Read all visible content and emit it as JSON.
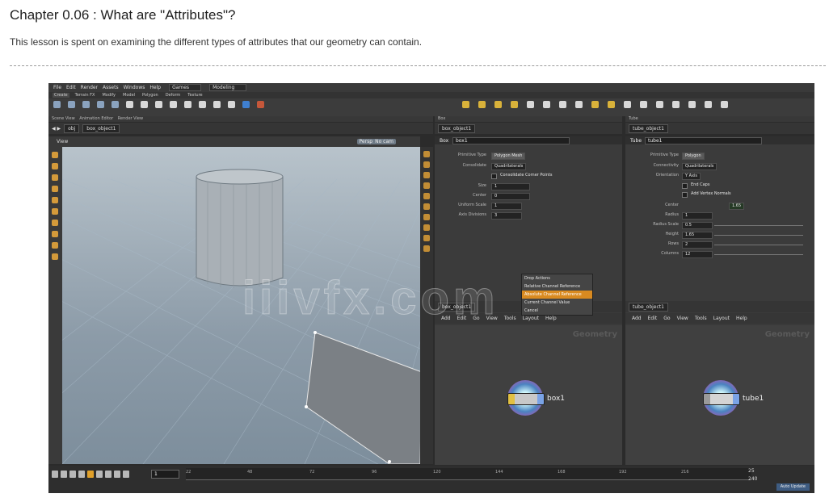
{
  "page": {
    "title": "Chapter 0.06 : What are \"Attributes\"?",
    "description": "This lesson is spent on examining the different types of attributes that our geometry can contain."
  },
  "houdini": {
    "menu": [
      "File",
      "Edit",
      "Render",
      "Assets",
      "Windows",
      "Help"
    ],
    "desktop": "Games",
    "desktop2": "Modeling",
    "viewport": {
      "label": "View",
      "persp": "Persp",
      "camera": "No cam"
    },
    "path_left": "obj",
    "path_left_node": "box_object1",
    "params_box": {
      "node_type": "Box",
      "node_name": "box1",
      "rows": [
        {
          "label": "Primitive Type",
          "value": "Polygon Mesh"
        },
        {
          "label": "Consolidate",
          "value": "Quadrilaterals"
        },
        {
          "label": "",
          "value": "Consolidate Corner Points"
        },
        {
          "label": "Size",
          "value": "1"
        },
        {
          "label": "Center",
          "value": "0"
        },
        {
          "label": "Uniform Scale",
          "value": "1"
        },
        {
          "label": "Axis Divisions",
          "value": "3"
        }
      ]
    },
    "context_menu": [
      "Drop Actions",
      "Relative Channel Reference",
      "Absolute Channel Reference",
      "Current Channel Value",
      "Cancel"
    ],
    "params_tube": {
      "node_type": "Tube",
      "node_name": "tube1",
      "rows": [
        {
          "label": "Primitive Type",
          "value": "Polygon"
        },
        {
          "label": "Connectivity",
          "value": "Quadrilaterals"
        },
        {
          "label": "Orientation",
          "value": "Y Axis"
        },
        {
          "label": "",
          "value": "End Caps"
        },
        {
          "label": "",
          "value": "Add Vertex Normals"
        },
        {
          "label": "Center",
          "value": "1.65"
        },
        {
          "label": "Radius",
          "value": "1"
        },
        {
          "label": "Radius Scale",
          "value": "0.5"
        },
        {
          "label": "Height",
          "value": "1.65"
        },
        {
          "label": "Rows",
          "value": "2"
        },
        {
          "label": "Columns",
          "value": "12"
        }
      ]
    },
    "net_left": {
      "path": "box_object1",
      "watermark": "Geometry",
      "node": "box1"
    },
    "net_right": {
      "path": "tube_object1",
      "watermark": "Geometry",
      "node": "tube1"
    },
    "net_menu": [
      "Add",
      "Edit",
      "Go",
      "View",
      "Tools",
      "Layout",
      "Help"
    ],
    "timeline": {
      "frame": "1",
      "ticks": [
        "22",
        "48",
        "72",
        "96",
        "120",
        "144",
        "168",
        "192",
        "216"
      ],
      "end_a": "25",
      "end_b": "240",
      "auto_update": "Auto Update"
    }
  },
  "watermark": "iiivfx.com"
}
